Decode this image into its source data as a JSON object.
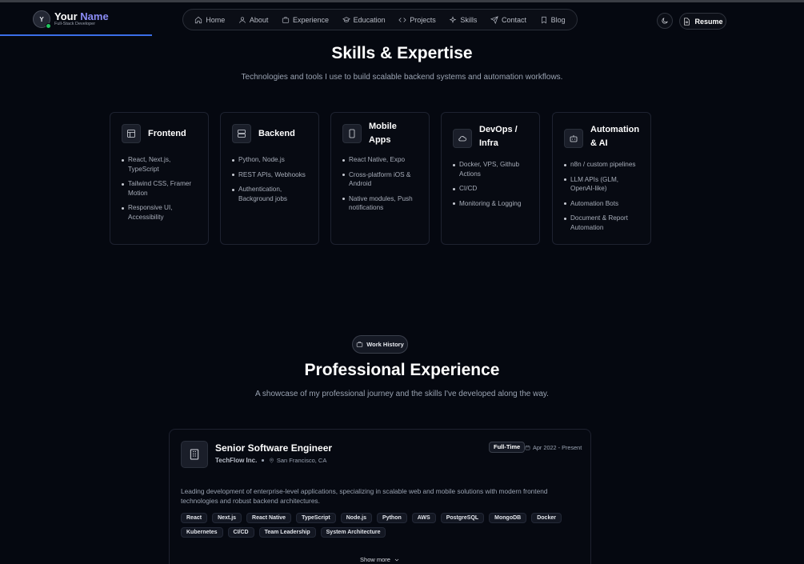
{
  "brand": {
    "initial": "Y",
    "name_first": "Your",
    "name_second": "Name",
    "subtitle": "Full-Stack Developer"
  },
  "nav": [
    {
      "label": "Home",
      "icon": "home-icon"
    },
    {
      "label": "About",
      "icon": "user-icon"
    },
    {
      "label": "Experience",
      "icon": "briefcase-icon"
    },
    {
      "label": "Education",
      "icon": "graduation-cap-icon"
    },
    {
      "label": "Projects",
      "icon": "code-icon"
    },
    {
      "label": "Skills",
      "icon": "sparkles-icon"
    },
    {
      "label": "Contact",
      "icon": "send-icon"
    },
    {
      "label": "Blog",
      "icon": "bookmark-icon"
    }
  ],
  "header": {
    "resume_label": "Resume",
    "theme_icon": "moon-icon"
  },
  "skills": {
    "title": "Skills & Expertise",
    "subtitle": "Technologies and tools I use to build scalable backend systems and automation workflows.",
    "cards": [
      {
        "title": "Frontend",
        "icon": "layout-icon",
        "items": [
          "React, Next.js, TypeScript",
          "Tailwind CSS, Framer Motion",
          "Responsive UI, Accessibility"
        ]
      },
      {
        "title": "Backend",
        "icon": "server-icon",
        "items": [
          "Python, Node.js",
          "REST APIs, Webhooks",
          "Authentication, Background jobs"
        ]
      },
      {
        "title": "Mobile Apps",
        "icon": "smartphone-icon",
        "items": [
          "React Native, Expo",
          "Cross-platform iOS & Android",
          "Native modules, Push notifications"
        ]
      },
      {
        "title": "DevOps / Infra",
        "icon": "cloud-icon",
        "items": [
          "Docker, VPS, Github Actions",
          "CI/CD",
          "Monitoring & Logging"
        ]
      },
      {
        "title": "Automation & AI",
        "icon": "bot-icon",
        "items": [
          "n8n / custom pipelines",
          "LLM APIs (GLM, OpenAI-like)",
          "Automation Bots",
          "Document & Report Automation"
        ]
      }
    ]
  },
  "experience": {
    "badge": "Work History",
    "title": "Professional Experience",
    "subtitle": "A showcase of my professional journey and the skills I've developed along the way.",
    "job": {
      "role": "Senior Software Engineer",
      "company": "TechFlow Inc.",
      "location": "San Francisco, CA",
      "type": "Full-Time",
      "dates": "Apr 2022 - Present",
      "description": "Leading development of enterprise-level applications, specializing in scalable web and mobile solutions with modern frontend technologies and robust backend architectures.",
      "tags": [
        "React",
        "Next.js",
        "React Native",
        "TypeScript",
        "Node.js",
        "Python",
        "AWS",
        "PostgreSQL",
        "MongoDB",
        "Docker",
        "Kubernetes",
        "CI/CD",
        "Team Leadership",
        "System Architecture"
      ]
    },
    "show_more": "Show more"
  }
}
